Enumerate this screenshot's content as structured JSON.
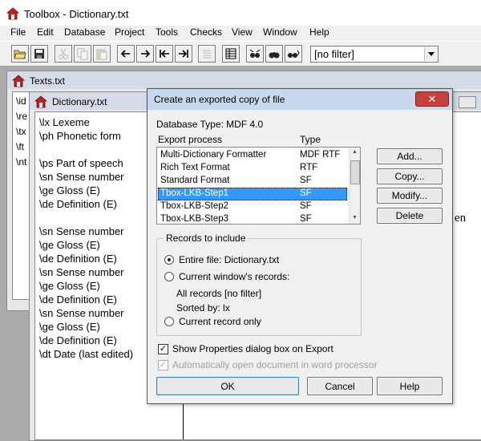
{
  "app": {
    "title": "Toolbox - Dictionary.txt",
    "icon": "toolbox-house-icon"
  },
  "menu": [
    "File",
    "Edit",
    "Database",
    "Project",
    "Tools",
    "Checks",
    "View",
    "Window",
    "Help"
  ],
  "toolbar": {
    "filter_value": "[no filter]",
    "buttons": [
      "open-folder-icon",
      "save-disk-icon",
      "cut-icon",
      "copy-icon",
      "paste-icon",
      "arrow-left-icon",
      "arrow-right-icon",
      "arrow-first-icon",
      "arrow-last-icon",
      "browse-icon",
      "table-icon",
      "jump-icon",
      "find-icon",
      "find-next-icon"
    ]
  },
  "texts_window": {
    "title": "Texts.txt",
    "lines": [
      "\\id",
      "\\re",
      "\\tx",
      "\\ft",
      "\\nt"
    ]
  },
  "dict_window": {
    "title": "Dictionary.txt",
    "fields": [
      "\\lx  Lexeme",
      "\\ph  Phonetic form",
      "",
      "\\ps  Part of speech",
      "\\sn  Sense number",
      "\\ge  Gloss (E)",
      "\\de  Definition (E)",
      "",
      "\\sn  Sense number",
      "\\ge  Gloss (E)",
      "\\de  Definition (E)",
      "\\sn  Sense number",
      "\\ge  Gloss (E)",
      "\\de  Definition (E)",
      "\\sn  Sense number",
      "\\ge  Gloss (E)",
      "\\de  Definition (E)",
      "\\dt  Date (last edited)"
    ],
    "right_fragment": "en"
  },
  "dialog": {
    "title": "Create an exported copy of file",
    "close_label": "✕",
    "database_type": "Database Type: MDF 4.0",
    "col_export": "Export process",
    "col_type": "Type",
    "export_processes": [
      {
        "name": "Multi-Dictionary Formatter",
        "type": "MDF RTF"
      },
      {
        "name": "Rich Text Format",
        "type": "RTF"
      },
      {
        "name": "Standard Format",
        "type": "SF"
      },
      {
        "name": "Tbox-LKB-Step1",
        "type": "SF"
      },
      {
        "name": "Tbox-LKB-Step2",
        "type": "SF"
      },
      {
        "name": "Tbox-LKB-Step3",
        "type": "SF"
      }
    ],
    "selected_index": 3,
    "buttons": {
      "add": "Add...",
      "copy": "Copy...",
      "modify": "Modify...",
      "delete": "Delete",
      "ok": "OK",
      "cancel": "Cancel",
      "help": "Help"
    },
    "records": {
      "legend": "Records to include",
      "entire_file": "Entire file: Dictionary.txt",
      "current_window": "Current window's records:",
      "all_records": "All records [no filter]",
      "sorted_by": "Sorted by: lx",
      "current_record": "Current record only",
      "selected": "entire_file"
    },
    "show_properties": {
      "label": "Show Properties dialog box on Export",
      "checked": true
    },
    "auto_open": {
      "label": "Automatically open document in word processor",
      "checked": true,
      "disabled": true
    }
  }
}
